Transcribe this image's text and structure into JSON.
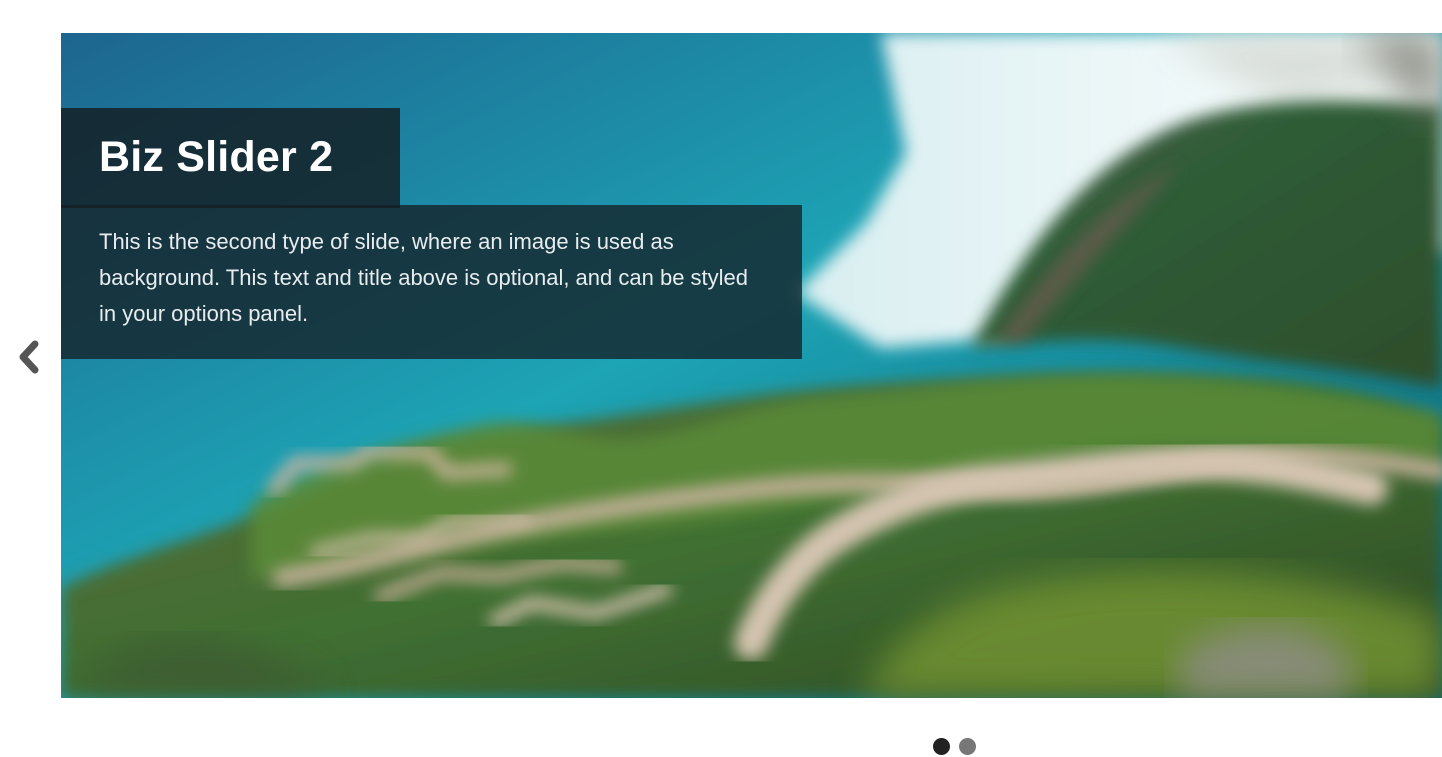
{
  "slider": {
    "title": "Biz Slider 2",
    "description": "This is the second type of slide, where an image is used as background. This text and title above is optional, and can be styled in your options panel.",
    "active_slide": 1,
    "slide_count": 2
  },
  "navigation": {
    "previous_icon": "chevron-left-icon"
  },
  "pager": {
    "dots": [
      {
        "state": "active",
        "color": "#222222"
      },
      {
        "state": "inactive",
        "color": "#777777"
      }
    ]
  },
  "colors": {
    "caption_background": "#141d22",
    "caption_text": "#e7ecef",
    "arrow": "#555555"
  }
}
